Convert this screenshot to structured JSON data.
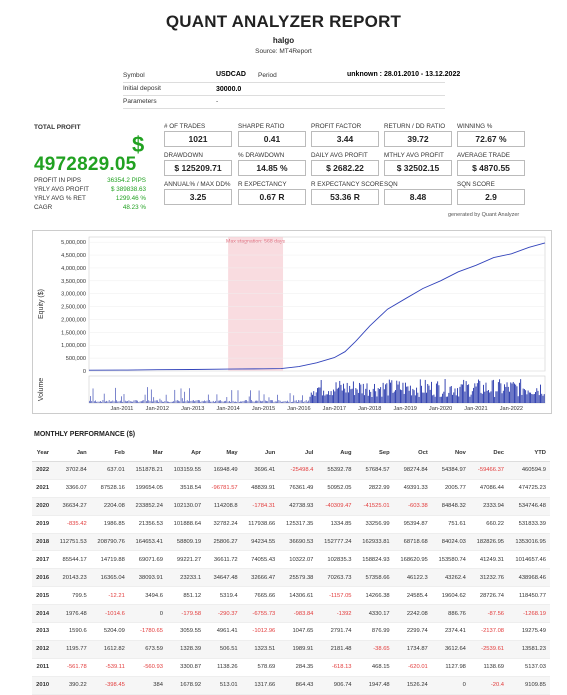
{
  "report": {
    "title": "QUANT ANALYZER REPORT",
    "author": "halgo",
    "source": "Source: MT4Report"
  },
  "info": {
    "symbol_label": "Symbol",
    "symbol_value": "USDCAD",
    "period_label": "Period",
    "period_value": "unknown : 28.01.2010 - 13.12.2022",
    "deposit_label": "Initial deposit",
    "deposit_value": "30000.0",
    "params_label": "Parameters",
    "params_value": "-"
  },
  "total_profit": {
    "label": "TOTAL PROFIT",
    "currency": "$",
    "value": "4972829.05",
    "rows": [
      {
        "label": "PROFIT IN PIPS",
        "value": "36354.2 PIPS"
      },
      {
        "label": "YRLY AVG PROFIT",
        "value": "$ 389838.63"
      },
      {
        "label": "YRLY AVG % RET",
        "value": "1299.46 %"
      },
      {
        "label": "CAGR",
        "value": "48.23 %"
      }
    ]
  },
  "metrics": [
    {
      "label": "# OF TRADES",
      "value": "1021"
    },
    {
      "label": "SHARPE RATIO",
      "value": "0.41"
    },
    {
      "label": "PROFIT FACTOR",
      "value": "3.44"
    },
    {
      "label": "RETURN / DD RATIO",
      "value": "39.72"
    },
    {
      "label": "WINNING %",
      "value": "72.67 %"
    },
    {
      "label": "DRAWDOWN",
      "value": "$ 125209.71"
    },
    {
      "label": "% DRAWDOWN",
      "value": "14.85 %"
    },
    {
      "label": "DAILY AVG PROFIT",
      "value": "$ 2682.22"
    },
    {
      "label": "MTHLY AVG PROFIT",
      "value": "$ 32502.15"
    },
    {
      "label": "AVERAGE TRADE",
      "value": "$ 4870.55"
    },
    {
      "label": "ANNUAL% / MAX DD%",
      "value": "3.25"
    },
    {
      "label": "R EXPECTANCY",
      "value": "0.67 R"
    },
    {
      "label": "R EXPECTANCY SCORE",
      "value": "53.36 R"
    },
    {
      "label": "SQN",
      "value": "8.48"
    },
    {
      "label": "SQN SCORE",
      "value": "2.9"
    }
  ],
  "generated_by": "generated by Quant Analyzer",
  "chart_data": {
    "type": "line",
    "ylabel": "Equity ($)",
    "volume_label": "Volume",
    "stagnation_label": "Max stagnation: 568 days",
    "stagnation_range": [
      2014.0,
      2015.55
    ],
    "x_range": [
      2010.07,
      2022.95
    ],
    "ylim": [
      0,
      5200000
    ],
    "y_ticks": [
      "0",
      "500,000",
      "1,000,000",
      "1,500,000",
      "2,000,000",
      "2,500,000",
      "3,000,000",
      "3,500,000",
      "4,000,000",
      "4,500,000",
      "5,000,000"
    ],
    "x_ticks": [
      "Jan-2011",
      "Jan-2012",
      "Jan-2013",
      "Jan-2014",
      "Jan-2015",
      "Jan-2016",
      "Jan-2017",
      "Jan-2018",
      "Jan-2019",
      "Jan-2020",
      "Jan-2021",
      "Jan-2022"
    ],
    "x": [
      2010.07,
      2011.0,
      2012.0,
      2013.0,
      2014.0,
      2015.0,
      2015.5,
      2016.0,
      2016.5,
      2017.0,
      2017.3,
      2017.6,
      2018.0,
      2018.5,
      2019.0,
      2019.5,
      2020.0,
      2020.5,
      2021.0,
      2021.5,
      2022.0,
      2022.5,
      2022.95
    ],
    "y": [
      30000,
      35000,
      50000,
      60000,
      75000,
      85000,
      95000,
      170000,
      320000,
      520000,
      750000,
      1150000,
      1750000,
      2400000,
      2800000,
      3200000,
      3500000,
      3850000,
      4100000,
      4400000,
      4550000,
      4800000,
      4970000
    ],
    "color": "#3344bb",
    "stagnation_color": "#f7d0d5"
  },
  "monthly": {
    "title": "MONTHLY PERFORMANCE ($)",
    "headers": [
      "Year",
      "Jan",
      "Feb",
      "Mar",
      "Apr",
      "May",
      "Jun",
      "Jul",
      "Aug",
      "Sep",
      "Oct",
      "Nov",
      "Dec",
      "YTD"
    ],
    "rows": [
      [
        "2022",
        "3702.84",
        "637.01",
        "151878.21",
        "103159.55",
        "16948.49",
        "3696.41",
        "-25498.4",
        "55392.78",
        "57684.57",
        "98274.84",
        "54384.97",
        "-59466.37",
        "460594.9"
      ],
      [
        "2021",
        "3366.07",
        "87528.16",
        "199654.05",
        "3518.54",
        "-96781.57",
        "48839.91",
        "76361.49",
        "50952.05",
        "2822.99",
        "49391.33",
        "2005.77",
        "47086.44",
        "474725.23"
      ],
      [
        "2020",
        "36634.27",
        "2204.08",
        "233852.24",
        "102130.07",
        "114208.8",
        "-1784.31",
        "42738.93",
        "-40309.47",
        "-41525.01",
        "-603.38",
        "84848.32",
        "2333.94",
        "534746.48"
      ],
      [
        "2019",
        "-835.42",
        "1986.85",
        "21356.53",
        "101888.64",
        "32782.24",
        "117938.66",
        "125317.35",
        "1334.85",
        "33256.99",
        "95394.87",
        "751.61",
        "660.22",
        "531833.39"
      ],
      [
        "2018",
        "112751.53",
        "208790.76",
        "164653.41",
        "58809.19",
        "25806.27",
        "94234.55",
        "36690.53",
        "152777.24",
        "162933.81",
        "68718.68",
        "84024.03",
        "182826.95",
        "1353016.95"
      ],
      [
        "2017",
        "85544.17",
        "14719.88",
        "69071.69",
        "99221.27",
        "36611.72",
        "74055.43",
        "10322.07",
        "102835.3",
        "158824.93",
        "168620.95",
        "153580.74",
        "41249.31",
        "1014657.46"
      ],
      [
        "2016",
        "20143.23",
        "16365.04",
        "38093.91",
        "23233.1",
        "34647.48",
        "32666.47",
        "25579.38",
        "70263.73",
        "57358.66",
        "46122.3",
        "43262.4",
        "31232.76",
        "438968.46"
      ],
      [
        "2015",
        "799.5",
        "-12.21",
        "3494.6",
        "851.12",
        "5319.4",
        "7665.66",
        "14306.61",
        "-1157.05",
        "14266.38",
        "24585.4",
        "19604.62",
        "28726.74",
        "118450.77"
      ],
      [
        "2014",
        "1976.48",
        "-1014.6",
        "0",
        "-179.58",
        "-290.37",
        "-6755.73",
        "-983.84",
        "-1392",
        "4330.17",
        "2242.08",
        "886.76",
        "-87.56",
        "-1268.19"
      ],
      [
        "2013",
        "1590.6",
        "5204.09",
        "-1780.65",
        "3059.55",
        "4961.41",
        "-1012.96",
        "1047.65",
        "2791.74",
        "876.99",
        "2299.74",
        "2374.41",
        "-2137.08",
        "19275.49"
      ],
      [
        "2012",
        "1195.77",
        "1612.82",
        "673.59",
        "1328.39",
        "506.51",
        "1323.51",
        "1989.91",
        "2181.48",
        "-38.65",
        "1734.87",
        "3612.64",
        "-2539.61",
        "13581.23"
      ],
      [
        "2011",
        "-561.78",
        "-539.11",
        "-560.93",
        "3300.87",
        "1138.26",
        "578.69",
        "284.35",
        "-618.13",
        "468.15",
        "-620.01",
        "1127.98",
        "1138.69",
        "5137.03"
      ],
      [
        "2010",
        "390.22",
        "-398.45",
        "384",
        "1678.92",
        "513.01",
        "1317.66",
        "864.43",
        "906.74",
        "1947.48",
        "1526.24",
        "0",
        "-20.4",
        "9109.85"
      ]
    ]
  }
}
